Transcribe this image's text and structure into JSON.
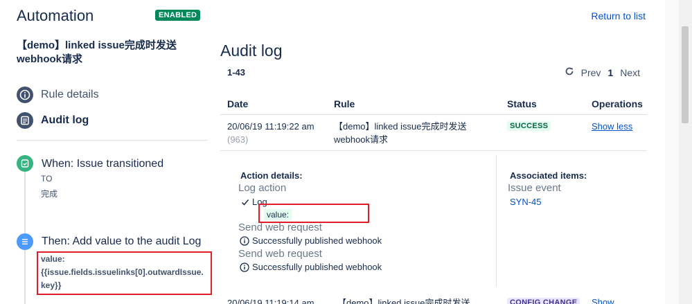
{
  "header": {
    "title": "Automation",
    "status_badge": "ENABLED",
    "rule_name": "【demo】linked issue完成时发送webhook请求",
    "return_link": "Return to list"
  },
  "nav": [
    {
      "label": "Rule details",
      "icon": "info-icon",
      "active": false
    },
    {
      "label": "Audit log",
      "icon": "list-icon",
      "active": true
    }
  ],
  "components": {
    "trigger": {
      "title": "When: Issue transitioned",
      "to_label": "TO",
      "to_value": "完成",
      "icon": "issue-transition-icon"
    },
    "action": {
      "title": "Then: Add value to the audit Log",
      "value_label": "value:",
      "value_expr": "{{issue.fields.issuelinks[0].outwardIssue.key}}",
      "icon": "audit-log-icon"
    }
  },
  "audit": {
    "title": "Audit log",
    "range": "1-43",
    "pager": {
      "prev": "Prev",
      "current": "1",
      "next": "Next"
    },
    "columns": [
      "Date",
      "Rule",
      "Status",
      "Operations"
    ],
    "rows": [
      {
        "date": "20/06/19 11:19:22 am",
        "id": "(963)",
        "rule": "【demo】linked issue完成时发送webhook请求",
        "status": "SUCCESS",
        "operation": "Show less"
      },
      {
        "date": "20/06/19 11:19:14 am",
        "rule": "【demo】linked issue完成时发送",
        "status": "CONFIG CHANGE",
        "operation": "Show"
      }
    ],
    "details": {
      "action_header": "Action details:",
      "actions": [
        {
          "name": "Log action",
          "result": "Log",
          "value": "value:"
        },
        {
          "name": "Send web request",
          "result": "Successfully published webhook"
        },
        {
          "name": "Send web request",
          "result": "Successfully published webhook"
        }
      ],
      "assoc_header": "Associated items:",
      "assoc_type": "Issue event",
      "assoc_key": "SYN-45"
    }
  },
  "colors": {
    "accent": "#0052cc",
    "success": "#00875a",
    "highlight": "#e11d2a"
  }
}
